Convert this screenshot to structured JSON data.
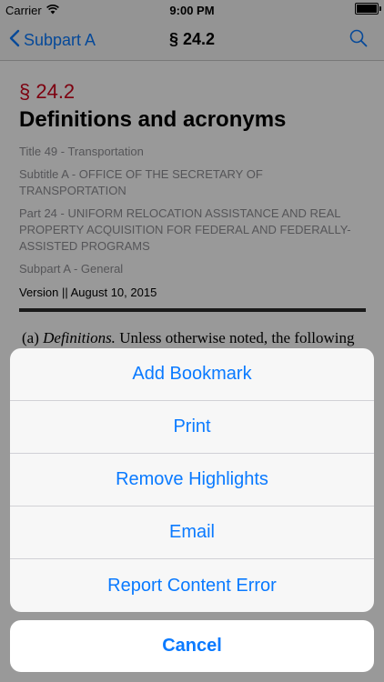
{
  "status_bar": {
    "carrier": "Carrier",
    "time": "9:00 PM",
    "battery_level": 1.0
  },
  "nav": {
    "back_label": "Subpart A",
    "title": "§ 24.2",
    "back_icon": "chevron-left-icon",
    "search_icon": "search-icon"
  },
  "doc": {
    "section_number": "§ 24.2",
    "section_title": "Definitions and acronyms",
    "title_line": "Title 49 - Transportation",
    "subtitle_line": "Subtitle A - OFFICE OF THE SECRETARY OF TRANSPORTATION",
    "part_line": "Part 24 - UNIFORM RELOCATION ASSISTANCE AND REAL PROPERTY ACQUISITION FOR FEDERAL AND FEDERALLY-ASSISTED PROGRAMS",
    "subpart_line": "Subpart A - General",
    "version": "Version || August 10, 2015",
    "para_prefix": "(a) ",
    "para_italic": "Definitions.",
    "para_rest": " Unless otherwise noted, the following"
  },
  "action_sheet": {
    "items": [
      {
        "label": "Add Bookmark"
      },
      {
        "label": "Print"
      },
      {
        "label": "Remove Highlights"
      },
      {
        "label": "Email"
      },
      {
        "label": "Report Content Error"
      }
    ],
    "cancel_label": "Cancel"
  },
  "colors": {
    "accent": "#0a7aff",
    "section_red": "#d0021b",
    "meta_gray": "#8e8e93"
  }
}
